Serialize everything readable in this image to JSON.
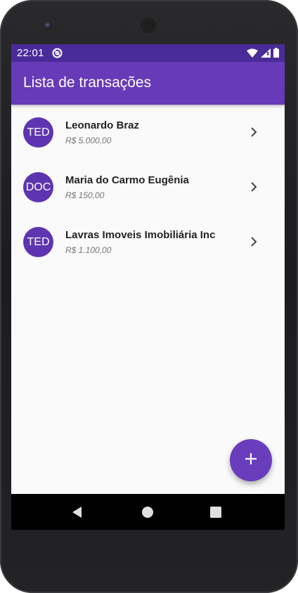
{
  "status_bar": {
    "time": "22:01",
    "app_icon": "at-sign-icon",
    "icons": [
      "wifi-icon",
      "cell-signal-icon",
      "battery-icon"
    ]
  },
  "app_bar": {
    "title": "Lista de transações"
  },
  "transactions": [
    {
      "type": "TED",
      "name": "Leonardo Braz",
      "value": "R$ 5.000,00"
    },
    {
      "type": "DOC",
      "name": "Maria do Carmo Eugênia",
      "value": "R$ 150,00"
    },
    {
      "type": "TED",
      "name": "Lavras Imoveis Imobiliária Inc",
      "value": "R$ 1.100,00"
    }
  ],
  "fab": {
    "icon": "plus-icon"
  },
  "nav_bar": {
    "icons": [
      "back-icon",
      "home-icon",
      "recents-icon"
    ]
  },
  "colors": {
    "status_bar": "#4a2b9a",
    "primary": "#673ab7",
    "avatar": "#5e35b1",
    "fab": "#6a3dbd",
    "background": "#fafafa"
  }
}
